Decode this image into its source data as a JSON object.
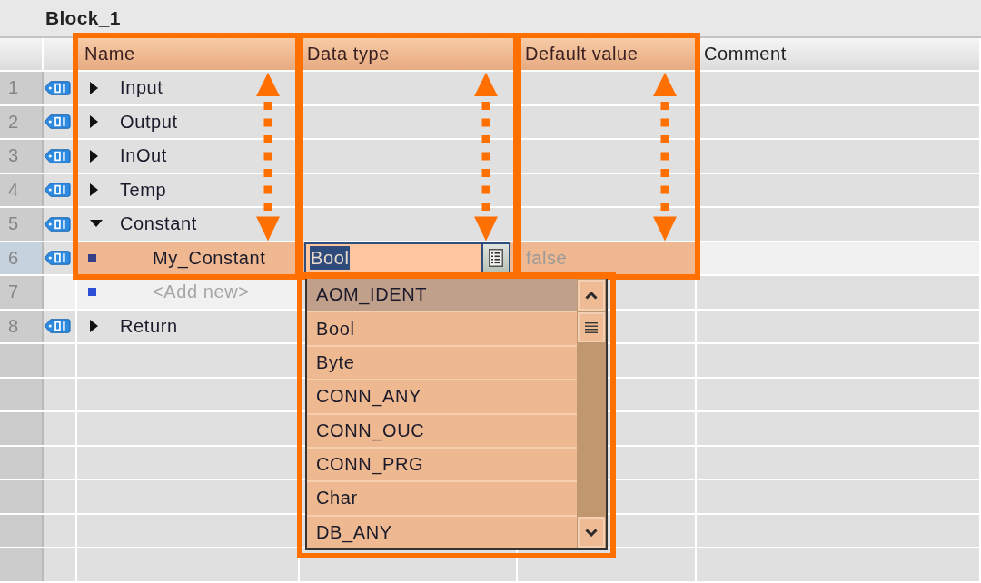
{
  "window": {
    "title": "Block_1"
  },
  "table": {
    "columns": [
      {
        "label": "Name",
        "highlighted": true
      },
      {
        "label": "Data type",
        "highlighted": true
      },
      {
        "label": "Default value",
        "highlighted": true
      },
      {
        "label": "Comment",
        "highlighted": false
      }
    ],
    "rows": [
      {
        "number": "1",
        "kind": "section",
        "name": "Input",
        "expanded": false,
        "selected": false
      },
      {
        "number": "2",
        "kind": "section",
        "name": "Output",
        "expanded": false,
        "selected": false
      },
      {
        "number": "3",
        "kind": "section",
        "name": "InOut",
        "expanded": false,
        "selected": false
      },
      {
        "number": "4",
        "kind": "section",
        "name": "Temp",
        "expanded": false,
        "selected": false
      },
      {
        "number": "5",
        "kind": "section",
        "name": "Constant",
        "expanded": true,
        "selected": false,
        "children": [
          {
            "number": "6",
            "kind": "member",
            "name": "My_Constant",
            "data_type": "Bool",
            "default_value": "false",
            "selected": true
          },
          {
            "number": "7",
            "kind": "add-new",
            "name": "<Add new>",
            "selected": false
          }
        ]
      },
      {
        "number": "8",
        "kind": "section",
        "name": "Return",
        "expanded": false,
        "selected": false
      }
    ],
    "dropdown": {
      "highlighted": true,
      "items": [
        {
          "label": "AOM_IDENT",
          "selected": true
        },
        {
          "label": "Bool",
          "selected": false
        },
        {
          "label": "Byte",
          "selected": false
        },
        {
          "label": "CONN_ANY",
          "selected": false
        },
        {
          "label": "CONN_OUC",
          "selected": false
        },
        {
          "label": "CONN_PRG",
          "selected": false
        },
        {
          "label": "Char",
          "selected": false
        },
        {
          "label": "DB_ANY",
          "selected": false
        }
      ]
    }
  }
}
